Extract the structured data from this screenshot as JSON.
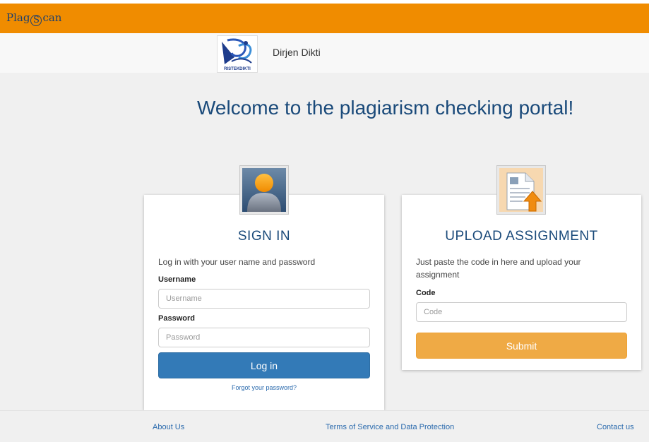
{
  "header": {
    "brand_prefix": "Plag",
    "brand_s": "S",
    "brand_suffix": "can"
  },
  "org": {
    "logo_text": "RISTEKDIKTI",
    "name": "Dirjen Dikti"
  },
  "welcome": "Welcome to the plagiarism checking portal!",
  "signin": {
    "icon": "user-avatar-icon",
    "title": "SIGN IN",
    "intro": "Log in with your user name and password",
    "username_label": "Username",
    "username_placeholder": "Username",
    "password_label": "Password",
    "password_placeholder": "Password",
    "login_button": "Log in",
    "forgot_link": "Forgot your password?"
  },
  "upload": {
    "icon": "document-upload-icon",
    "title": "UPLOAD ASSIGNMENT",
    "intro": "Just paste the code in here and upload your assignment",
    "code_label": "Code",
    "code_placeholder": "Code",
    "submit_button": "Submit"
  },
  "footer": {
    "about": "About Us",
    "terms": "Terms of Service and Data Protection",
    "contact": "Contact us"
  },
  "colors": {
    "topbar": "#f08c00",
    "primary": "#337ab7",
    "warning": "#efaa45",
    "heading": "#1a4a7a"
  }
}
